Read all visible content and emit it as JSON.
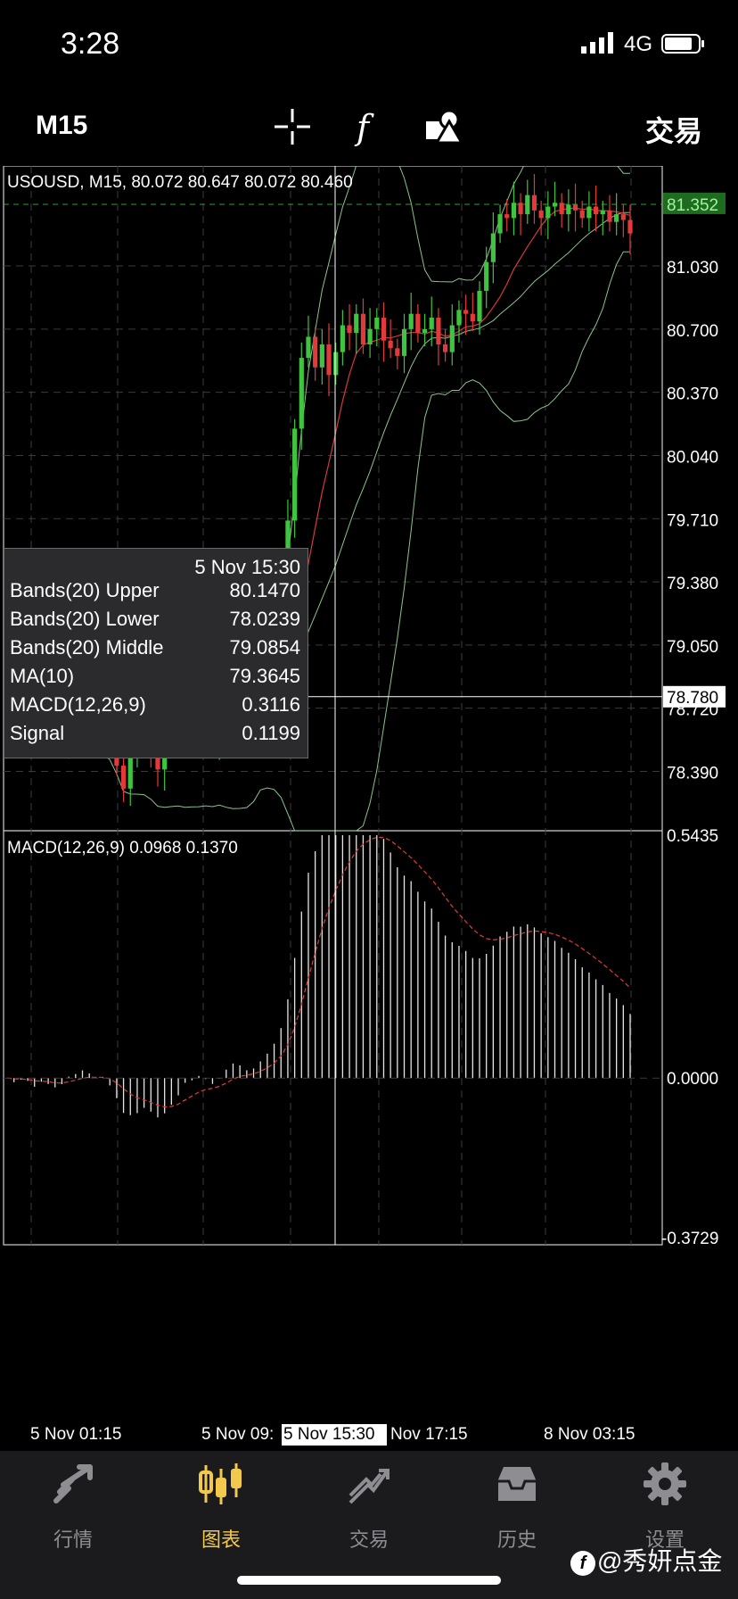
{
  "status_bar": {
    "time": "3:28",
    "network": "4G",
    "signal_icon": "cell-signal-icon",
    "battery_icon": "battery-icon"
  },
  "toolbar": {
    "timeframe": "M15",
    "trade_label": "交易",
    "icons": [
      "crosshair-icon",
      "function-icon",
      "objects-icon"
    ]
  },
  "chart": {
    "header": "USOUSD, M15, 80.072 80.647 80.072 80.460",
    "price_ticks": [
      "81.030",
      "80.700",
      "80.370",
      "80.040",
      "79.710",
      "79.380",
      "79.050",
      "78.720",
      "78.390"
    ],
    "bid_price": "81.352",
    "crosshair_price": "78.780",
    "macd_header": "MACD(12,26,9) 0.0968 0.1370",
    "macd_ticks": [
      "0.5435",
      "0.0000",
      "-0.3729"
    ],
    "time_ticks": [
      "5 Nov 01:15",
      "5 Nov 09:",
      "Nov 17:15",
      "8 Nov 03:15"
    ],
    "crosshair_time": "5 Nov 15:30",
    "colors": {
      "bull": "#3ec43e",
      "bear": "#e23a3a",
      "bands": "#8bc48b",
      "ma": "#d43a3a",
      "grid": "#3b3b3b",
      "bid_bg": "#1f6b1f"
    }
  },
  "chart_data": {
    "type": "candlestick",
    "symbol": "USOUSD",
    "timeframe": "M15",
    "ohlc_header": [
      80.072,
      80.647,
      80.072,
      80.46
    ],
    "y_range": [
      78.08,
      81.65
    ],
    "close": [
      78.78,
      78.68,
      78.82,
      78.74,
      78.62,
      78.85,
      78.7,
      78.66,
      78.8,
      78.92,
      78.84,
      78.88,
      78.74,
      78.7,
      78.78,
      78.58,
      78.42,
      78.3,
      78.52,
      78.6,
      78.68,
      78.48,
      78.4,
      78.6,
      78.72,
      78.78,
      78.9,
      78.72,
      78.78,
      78.62,
      78.56,
      78.78,
      78.9,
      78.88,
      78.72,
      78.64,
      78.78,
      78.92,
      78.98,
      79.08,
      79.28,
      79.7,
      80.18,
      80.55,
      80.66,
      80.5,
      80.62,
      80.46,
      80.58,
      80.72,
      80.68,
      80.78,
      80.62,
      80.7,
      80.76,
      80.64,
      80.6,
      80.56,
      80.7,
      80.78,
      80.68,
      80.7,
      80.76,
      80.62,
      80.58,
      80.72,
      80.8,
      80.78,
      80.74,
      80.9,
      81.05,
      81.2,
      81.3,
      81.28,
      81.36,
      81.3,
      81.4,
      81.32,
      81.28,
      81.34,
      81.36,
      81.3,
      81.35,
      81.32,
      81.28,
      81.34,
      81.3,
      81.32,
      81.26,
      81.3,
      81.27,
      81.2
    ],
    "macd_range": [
      -0.3729,
      0.5435
    ],
    "macd_latest": 0.0968,
    "signal_latest": 0.137,
    "tooltip": {
      "time": "5 Nov 15:30",
      "bands_upper": 80.147,
      "bands_lower": 78.0239,
      "bands_middle": 79.0854,
      "ma10": 79.3645,
      "macd": 0.3116,
      "signal": 0.1199
    }
  },
  "info": {
    "date": "5 Nov 15:30",
    "rows": [
      {
        "k": "Bands(20) Upper",
        "v": "80.1470"
      },
      {
        "k": "Bands(20) Lower",
        "v": "78.0239"
      },
      {
        "k": "Bands(20) Middle",
        "v": "79.0854"
      },
      {
        "k": "MA(10)",
        "v": "79.3645"
      },
      {
        "k": "MACD(12,26,9)",
        "v": "0.3116"
      },
      {
        "k": "Signal",
        "v": "0.1199"
      }
    ]
  },
  "tabs": [
    {
      "label": "行情",
      "icon": "quotes-icon"
    },
    {
      "label": "图表",
      "icon": "chart-candles-icon"
    },
    {
      "label": "交易",
      "icon": "trade-icon"
    },
    {
      "label": "历史",
      "icon": "history-icon"
    },
    {
      "label": "设置",
      "icon": "settings-gear-icon"
    }
  ],
  "watermark": "@秀妍点金"
}
